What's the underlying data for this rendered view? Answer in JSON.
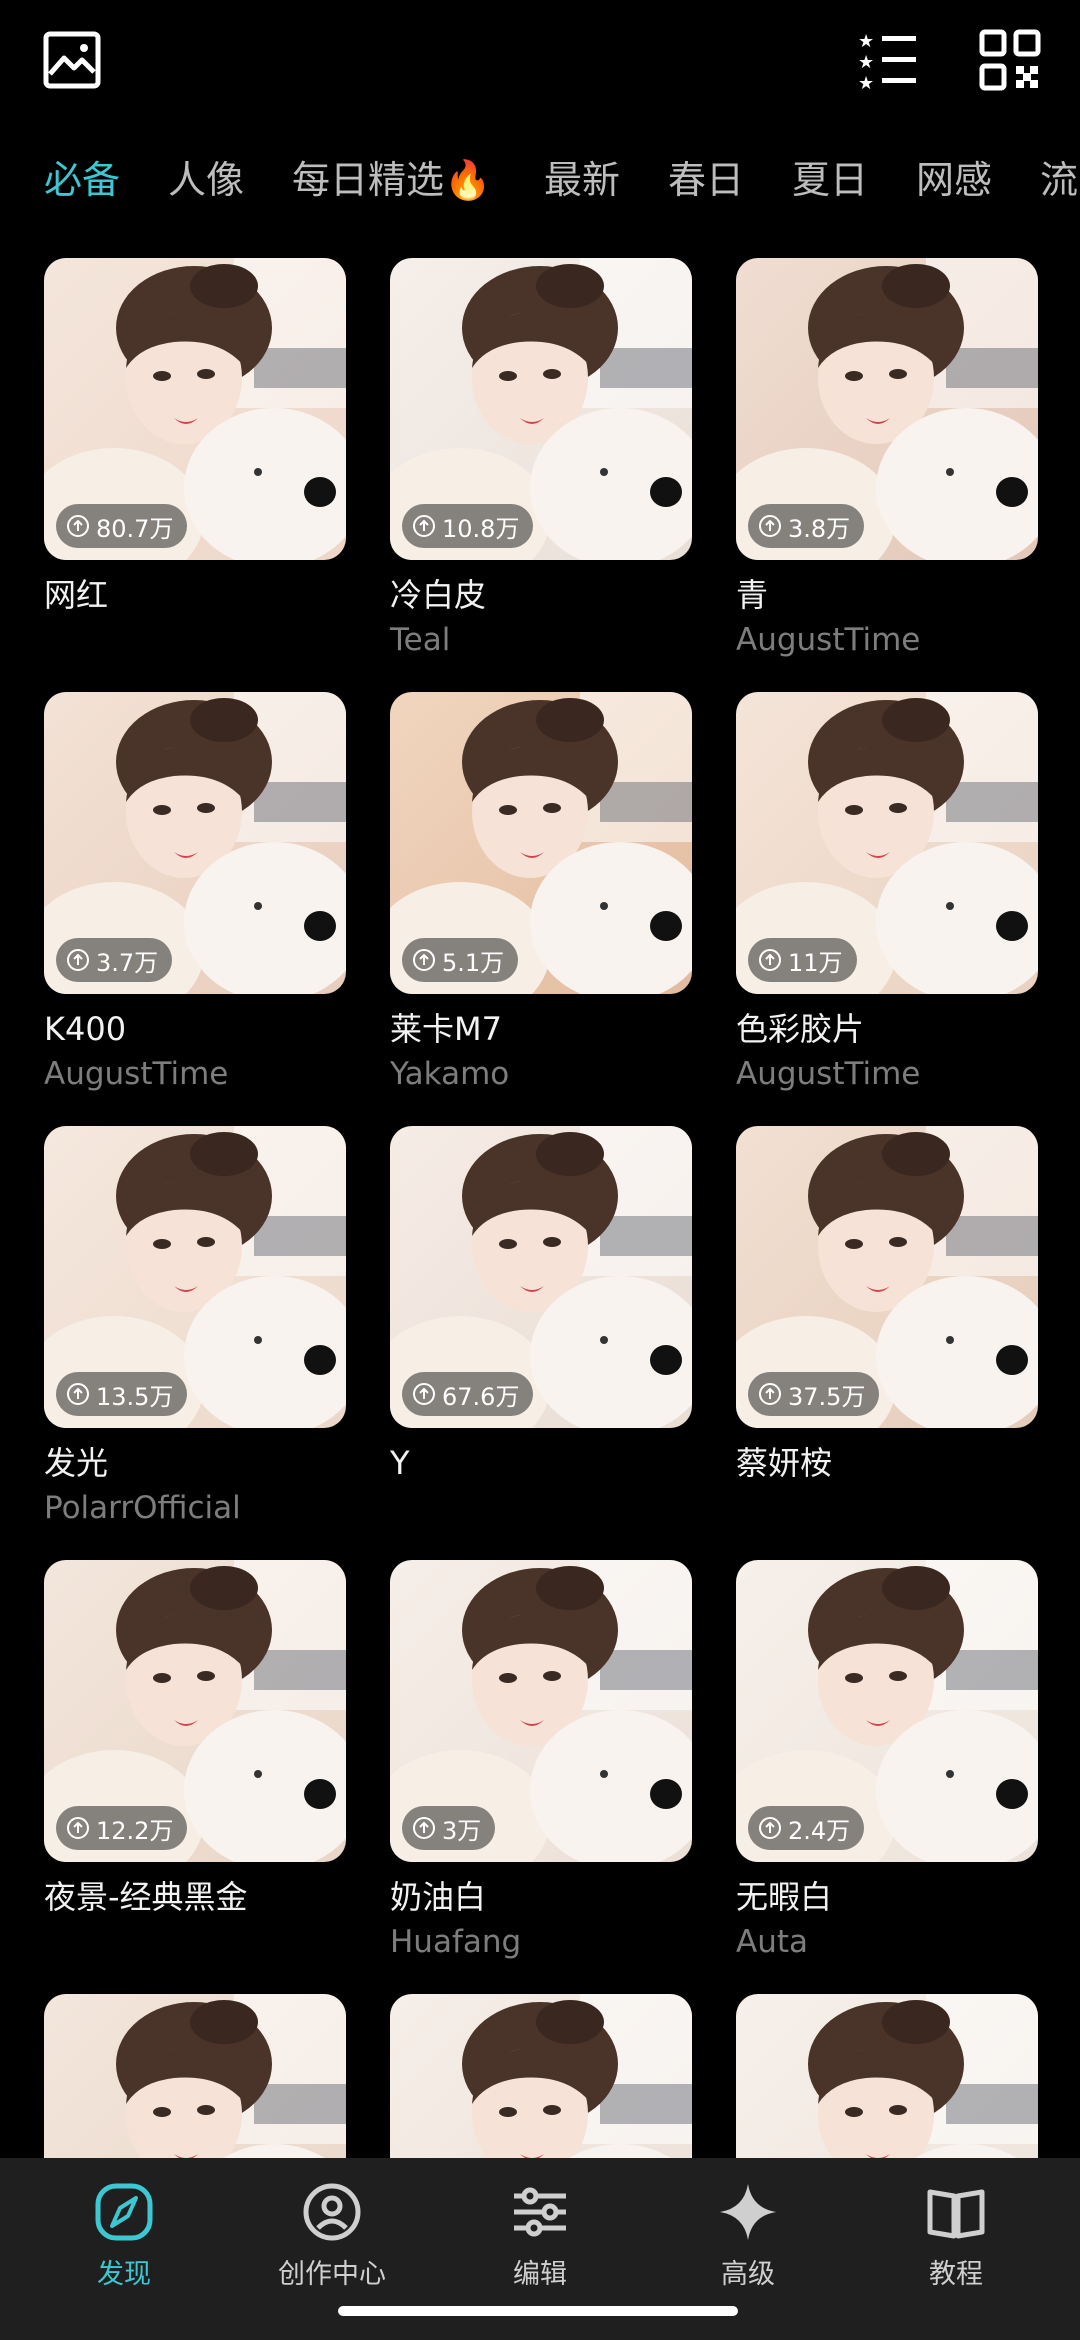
{
  "header": {
    "left_icon": "gallery-icon",
    "right_icons": [
      "filter-list-icon",
      "qr-code-icon"
    ]
  },
  "tabs": [
    {
      "label": "必备",
      "active": true
    },
    {
      "label": "人像"
    },
    {
      "label": "每日精选🔥"
    },
    {
      "label": "最新"
    },
    {
      "label": "春日"
    },
    {
      "label": "夏日"
    },
    {
      "label": "网感"
    },
    {
      "label": "流"
    }
  ],
  "filters": [
    {
      "title": "网红",
      "author": "",
      "count": "80.7万"
    },
    {
      "title": "冷白皮",
      "author": "Teal",
      "count": "10.8万"
    },
    {
      "title": "青",
      "author": "AugustTime",
      "count": "3.8万"
    },
    {
      "title": "K400",
      "author": "AugustTime",
      "count": "3.7万"
    },
    {
      "title": "莱卡M7",
      "author": "Yakamo",
      "count": "5.1万"
    },
    {
      "title": "色彩胶片",
      "author": "AugustTime",
      "count": "11万"
    },
    {
      "title": "发光",
      "author": "PolarrOfficial",
      "count": "13.5万"
    },
    {
      "title": "Y",
      "author": "",
      "count": "67.6万"
    },
    {
      "title": "蔡妍桉",
      "author": "",
      "count": "37.5万"
    },
    {
      "title": "夜景-经典黑金",
      "author": "",
      "count": "12.2万"
    },
    {
      "title": "奶油白",
      "author": "Huafang",
      "count": "3万"
    },
    {
      "title": "无暇白",
      "author": "Auta",
      "count": "2.4万"
    },
    {
      "title": "",
      "author": "",
      "count": ""
    },
    {
      "title": "",
      "author": "",
      "count": ""
    },
    {
      "title": "",
      "author": "",
      "count": ""
    }
  ],
  "bottom_nav": [
    {
      "label": "发现",
      "icon": "compass-icon",
      "active": true
    },
    {
      "label": "创作中心",
      "icon": "user-circle-icon"
    },
    {
      "label": "编辑",
      "icon": "sliders-icon"
    },
    {
      "label": "高级",
      "icon": "sparkle-icon"
    },
    {
      "label": "教程",
      "icon": "book-icon"
    }
  ],
  "colors": {
    "accent": "#3cc8d2",
    "background": "#000000",
    "nav_background": "#1f1f1f"
  }
}
